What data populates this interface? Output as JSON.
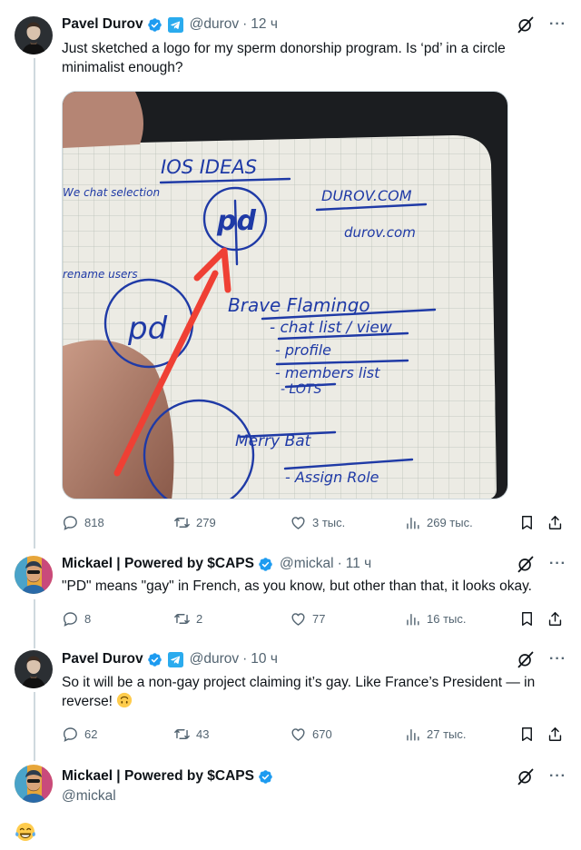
{
  "tweets": [
    {
      "name": "Pavel Durov",
      "handle": "@durov",
      "time": "12 ч",
      "text": "Just sketched a logo for my sperm donorship program. Is ‘pd’ in a circle minimalist enough?",
      "stats": {
        "replies": "818",
        "reposts": "279",
        "likes": "3 тыс.",
        "views": "269 тыс."
      }
    },
    {
      "name": "Mickael | Powered by $CAPS",
      "handle": "@mickal",
      "time": "11 ч",
      "text": "\"PD\" means \"gay\" in French, as you know, but other than that, it looks okay.",
      "stats": {
        "replies": "8",
        "reposts": "2",
        "likes": "77",
        "views": "16 тыс."
      }
    },
    {
      "name": "Pavel Durov",
      "handle": "@durov",
      "time": "10 ч",
      "text": "So it will be a non-gay project claiming it’s gay. Like France’s President — in reverse!",
      "emoji": "upside-down-face",
      "stats": {
        "replies": "62",
        "reposts": "43",
        "likes": "670",
        "views": "27 тыс."
      }
    }
  ],
  "compose": {
    "name": "Mickael | Powered by $CAPS",
    "handle": "@mickal",
    "body_emoji": "face-with-tears-of-joy"
  },
  "sketch": {
    "lines": [
      "IOS IDEAS",
      "DUROV.COM",
      "durov.com",
      "Brave Flamingo",
      "- chat list / view",
      "- profile",
      "- members list",
      "- LOTS",
      "Merry Bat",
      "- Assign Role",
      "We chat selection",
      "rename users"
    ]
  },
  "colors": {
    "verified": "#1d9bf0",
    "telegram": "#2aabee",
    "muted": "#536471",
    "ink": "#1f3aa6",
    "arrow": "#ef4034"
  },
  "icons": [
    "reply-icon",
    "repost-icon",
    "like-icon",
    "views-icon",
    "bookmark-icon",
    "share-icon",
    "grok-icon",
    "more-icon",
    "verified-icon",
    "telegram-icon"
  ]
}
